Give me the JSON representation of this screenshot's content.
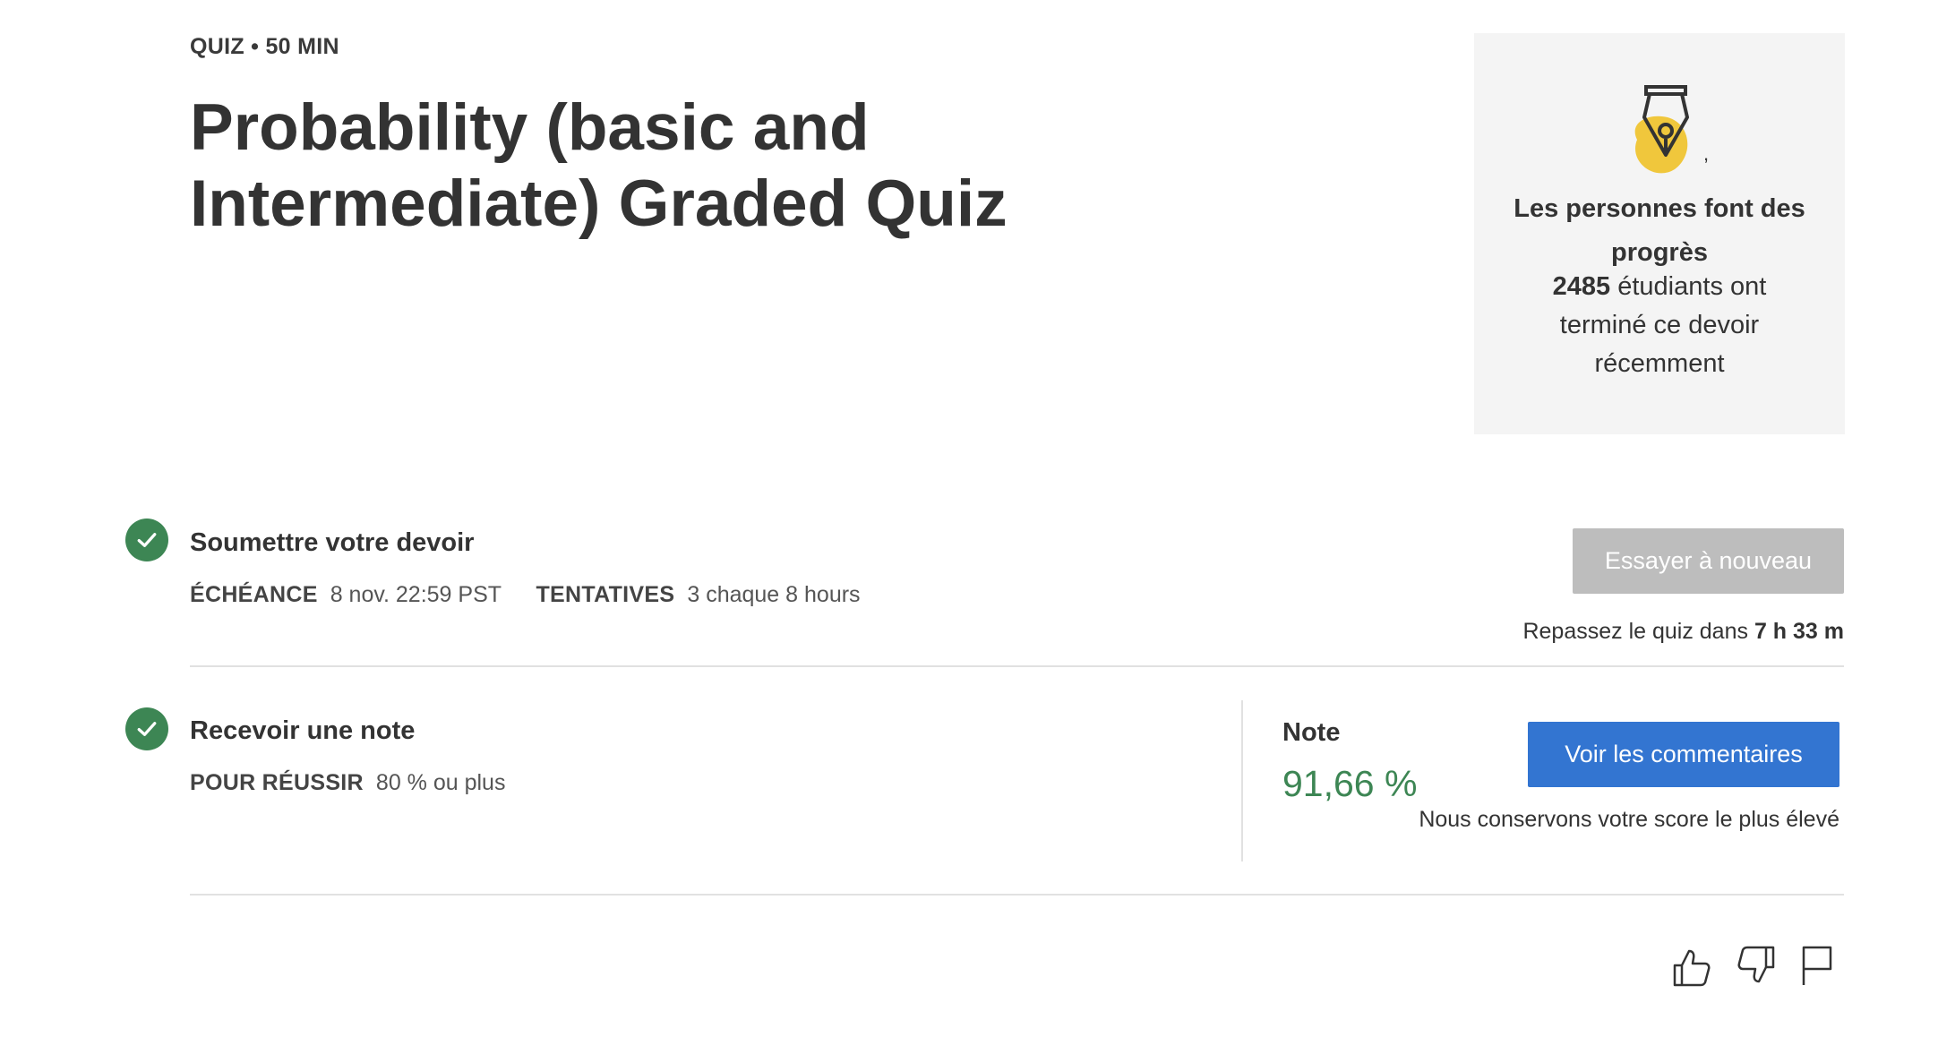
{
  "header": {
    "eyebrow": "QUIZ • 50  MIN",
    "title": "Probability (basic and Intermediate) Graded Quiz"
  },
  "progress_card": {
    "icon": "pen-nib-icon",
    "comma": ",",
    "heading": "Les personnes font des progrès",
    "count": "2485",
    "text": " étudiants ont terminé ce devoir récemment",
    "accent_color": "#f0c73c"
  },
  "submit": {
    "title": "Soumettre votre devoir",
    "due_label": "ÉCHÉANCE",
    "due_value": "8 nov. 22:59 PST",
    "attempts_label": "TENTATIVES",
    "attempts_value": "3 chaque 8  hours",
    "retry_button": "Essayer à nouveau",
    "retry_prefix": "Repassez le quiz dans ",
    "retry_time": "7 h 33 m"
  },
  "grade": {
    "title": "Recevoir une note",
    "pass_label": "POUR RÉUSSIR",
    "pass_value": "80 % ou plus",
    "grade_label": "Note",
    "grade_value": "91,66 %",
    "feedback_button": "Voir les commentaires",
    "keep_score": "Nous conservons votre score le plus élevé"
  },
  "colors": {
    "success": "#3d8654",
    "primary": "#3375d1",
    "disabled": "#bdbdbd"
  },
  "footer_icons": [
    "thumbs-up-icon",
    "thumbs-down-icon",
    "flag-icon"
  ]
}
